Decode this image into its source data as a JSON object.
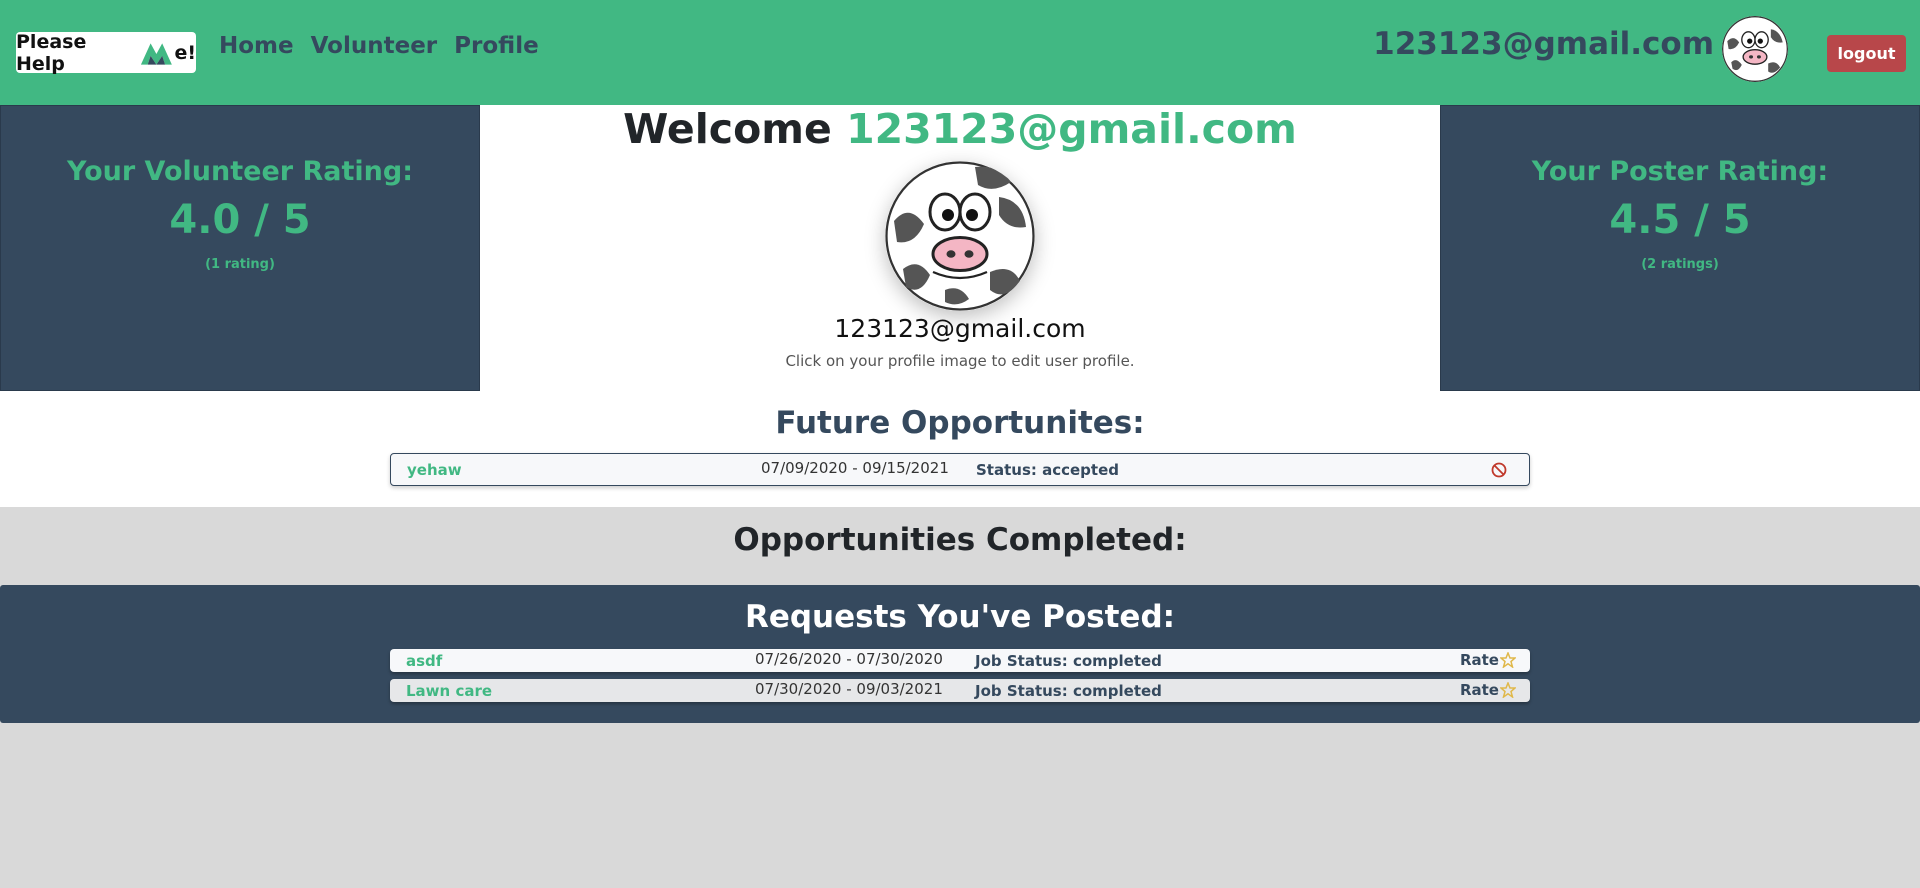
{
  "navbar": {
    "brand_prefix": "Please Help",
    "brand_suffix": "e!",
    "links": [
      "Home",
      "Volunteer",
      "Profile"
    ],
    "user_email": "123123@gmail.com",
    "logout_label": "logout",
    "accent_color": "#41b883",
    "dark_color": "#35495e"
  },
  "profile": {
    "welcome_prefix": "Welcome",
    "welcome_email": "123123@gmail.com",
    "email": "123123@gmail.com",
    "hint": "Click on your profile image to edit user profile.",
    "avatar_icon": "cow-avatar-icon"
  },
  "ratings": {
    "volunteer": {
      "title": "Your Volunteer Rating:",
      "value": "4.0 / 5",
      "count": "(1 rating)"
    },
    "poster": {
      "title": "Your Poster Rating:",
      "value": "4.5 / 5",
      "count": "(2 ratings)"
    }
  },
  "future": {
    "title": "Future Opportunites:",
    "items": [
      {
        "name": "yehaw",
        "dates": "07/09/2020 - 09/15/2021",
        "status": "Status: accepted",
        "action_icon": "cancel-icon"
      }
    ]
  },
  "completed": {
    "title": "Opportunities Completed:"
  },
  "posted": {
    "title": "Requests You've Posted:",
    "items": [
      {
        "name": "asdf",
        "dates": "07/26/2020 - 07/30/2020",
        "status": "Job Status: completed",
        "action": "Rate"
      },
      {
        "name": "Lawn care",
        "dates": "07/30/2020 - 09/03/2021",
        "status": "Job Status: completed",
        "action": "Rate"
      }
    ]
  }
}
